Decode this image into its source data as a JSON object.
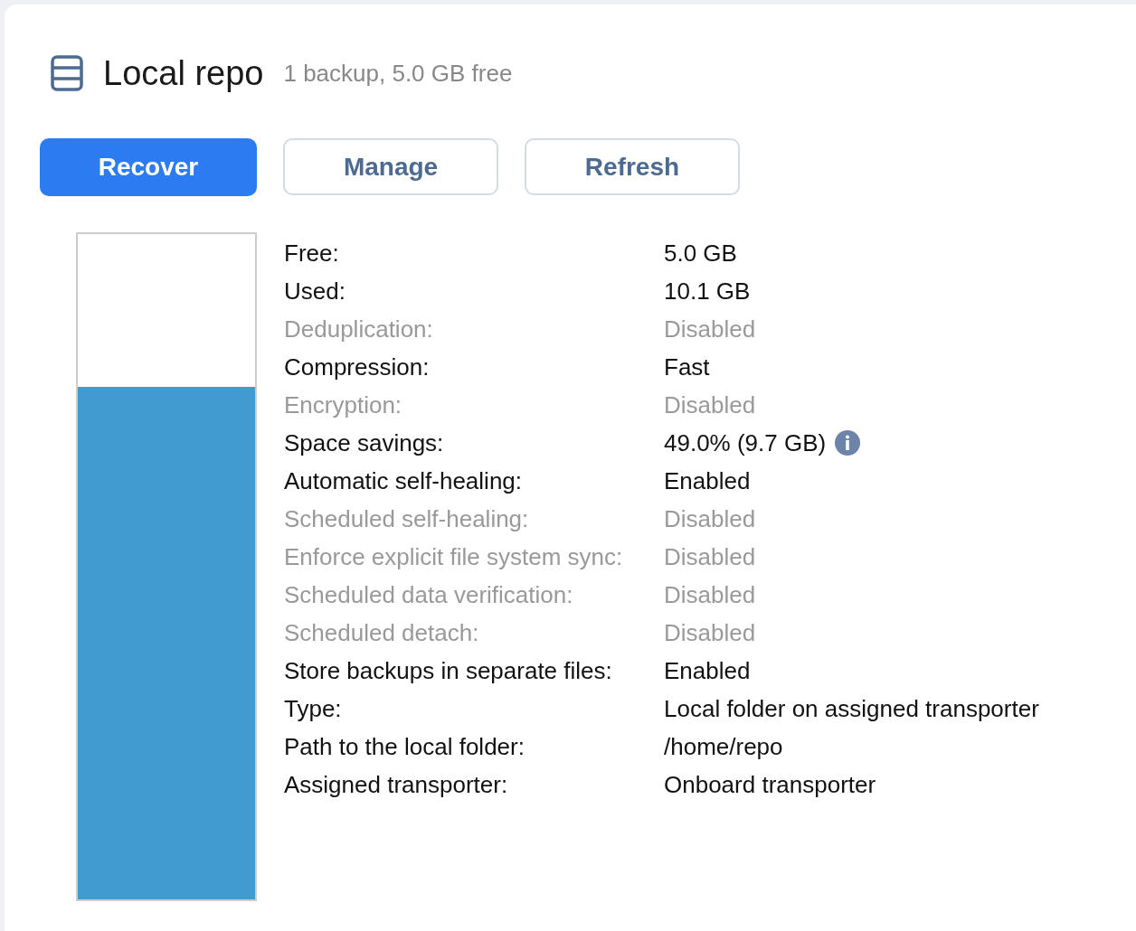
{
  "header": {
    "title": "Local repo",
    "summary": "1 backup, 5.0 GB free"
  },
  "buttons": [
    {
      "label": "Recover",
      "primary": true
    },
    {
      "label": "Manage",
      "primary": false
    },
    {
      "label": "Refresh",
      "primary": false
    }
  ],
  "usage_bar": {
    "level": 0.77
  },
  "properties": [
    {
      "label": "Free:",
      "value": "5.0 GB",
      "dimmed": false,
      "info": false
    },
    {
      "label": "Used:",
      "value": "10.1 GB",
      "dimmed": false,
      "info": false
    },
    {
      "label": "Deduplication:",
      "value": "Disabled",
      "dimmed": true,
      "info": false
    },
    {
      "label": "Compression:",
      "value": "Fast",
      "dimmed": false,
      "info": false
    },
    {
      "label": "Encryption:",
      "value": "Disabled",
      "dimmed": true,
      "info": false
    },
    {
      "label": "Space savings:",
      "value": "49.0% (9.7 GB)",
      "dimmed": false,
      "info": true
    },
    {
      "label": "Automatic self-healing:",
      "value": "Enabled",
      "dimmed": false,
      "info": false
    },
    {
      "label": "Scheduled self-healing:",
      "value": "Disabled",
      "dimmed": true,
      "info": false
    },
    {
      "label": "Enforce explicit file system sync:",
      "value": "Disabled",
      "dimmed": true,
      "info": false
    },
    {
      "label": "Scheduled data verification:",
      "value": "Disabled",
      "dimmed": true,
      "info": false
    },
    {
      "label": "Scheduled detach:",
      "value": "Disabled",
      "dimmed": true,
      "info": false
    },
    {
      "label": "Store backups in separate files:",
      "value": "Enabled",
      "dimmed": false,
      "info": false
    },
    {
      "label": "Type:",
      "value": "Local folder on assigned transporter",
      "dimmed": false,
      "info": false
    },
    {
      "label": "Path to the local folder:",
      "value": "/home/repo",
      "dimmed": false,
      "info": false
    },
    {
      "label": "Assigned transporter:",
      "value": "Onboard transporter",
      "dimmed": false,
      "info": false
    }
  ]
}
